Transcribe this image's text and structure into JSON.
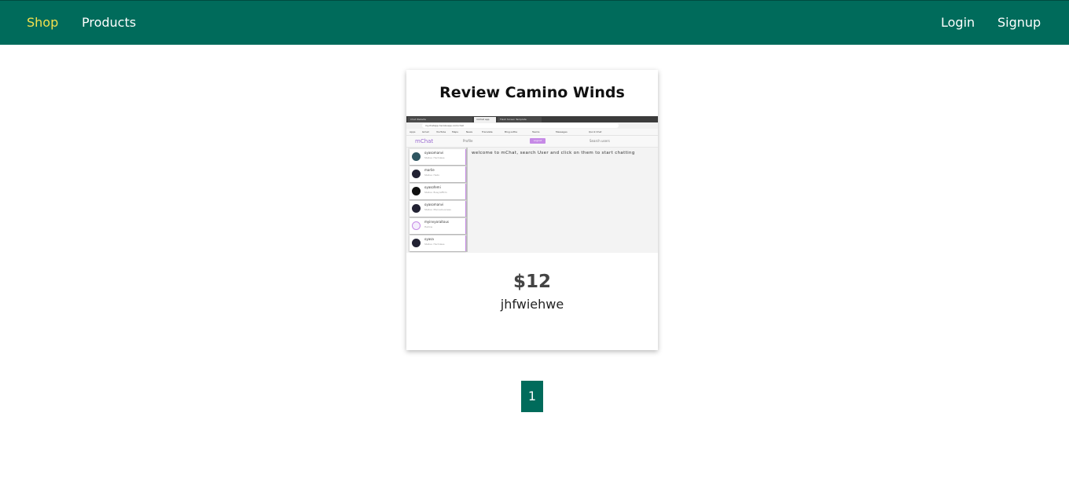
{
  "navbar": {
    "left_links": [
      "Shop",
      "Products"
    ],
    "right_links": [
      "Login",
      "Signup"
    ],
    "active": "Shop",
    "colors": {
      "background": "#006b5b",
      "active_link": "#f4e04d",
      "link": "#ffffff"
    }
  },
  "product": {
    "title": "Review Camino Winds",
    "price": "$12",
    "description": "jhfwiehwe",
    "thumbnail": {
      "tabs": [
        "Chat Website",
        "mChat app",
        "Flash Screen Template"
      ],
      "address": "mychatapp.herokuapp.com/chat",
      "bookmarks": [
        "Apps",
        "Gmail",
        "YouTube",
        "Maps",
        "News",
        "Translate",
        "Blog.Lottie",
        "Teams",
        "Messages",
        "Quick Chat"
      ],
      "brand": "mChat",
      "profile_label": "Profile",
      "logout_label": "Logout",
      "search_label": "Search users",
      "users": [
        {
          "name": "oyasomanvi",
          "status": "Status: Harmless"
        },
        {
          "name": "marlie",
          "status": "Status: Hello"
        },
        {
          "name": "oyasofemi",
          "status": "Status: Busy/affirm"
        },
        {
          "name": "oyasomanvi",
          "status": "Status: Marvelousness"
        },
        {
          "name": "myinvyoraitous",
          "status": "Hellow"
        },
        {
          "name": "oyasa",
          "status": "Status: Harmless"
        }
      ],
      "welcome": "welcome to mChat, search User and click on them to start chatting"
    }
  },
  "pagination": {
    "pages": [
      "1"
    ],
    "current": "1"
  }
}
